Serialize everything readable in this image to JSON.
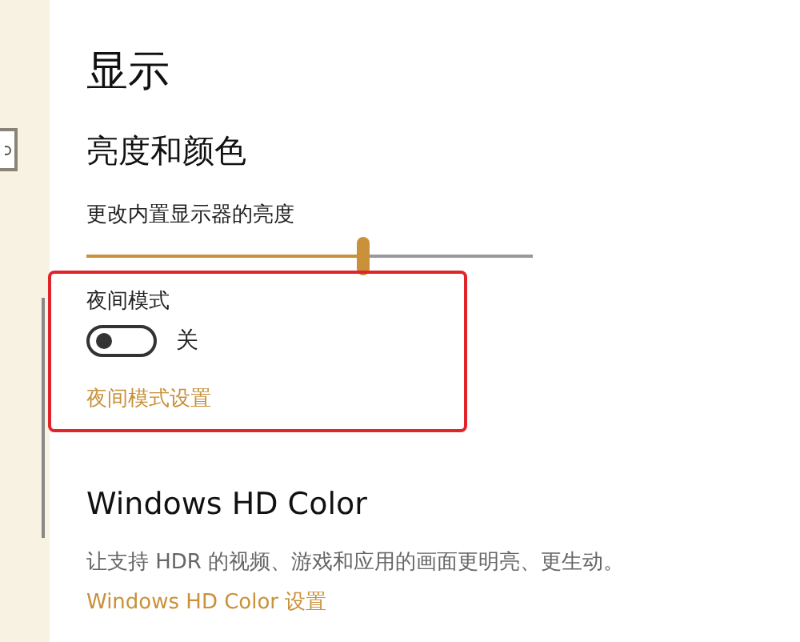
{
  "page": {
    "title": "显示"
  },
  "brightness": {
    "heading": "亮度和颜色",
    "label": "更改内置显示器的亮度",
    "level": 0.62
  },
  "night_light": {
    "label": "夜间模式",
    "on": false,
    "state_text": "关",
    "link": "夜间模式设置"
  },
  "hd_color": {
    "heading": "Windows HD Color",
    "description": "让支持 HDR 的视频、游戏和应用的画面更明亮、更生动。",
    "link": "Windows HD Color 设置"
  }
}
